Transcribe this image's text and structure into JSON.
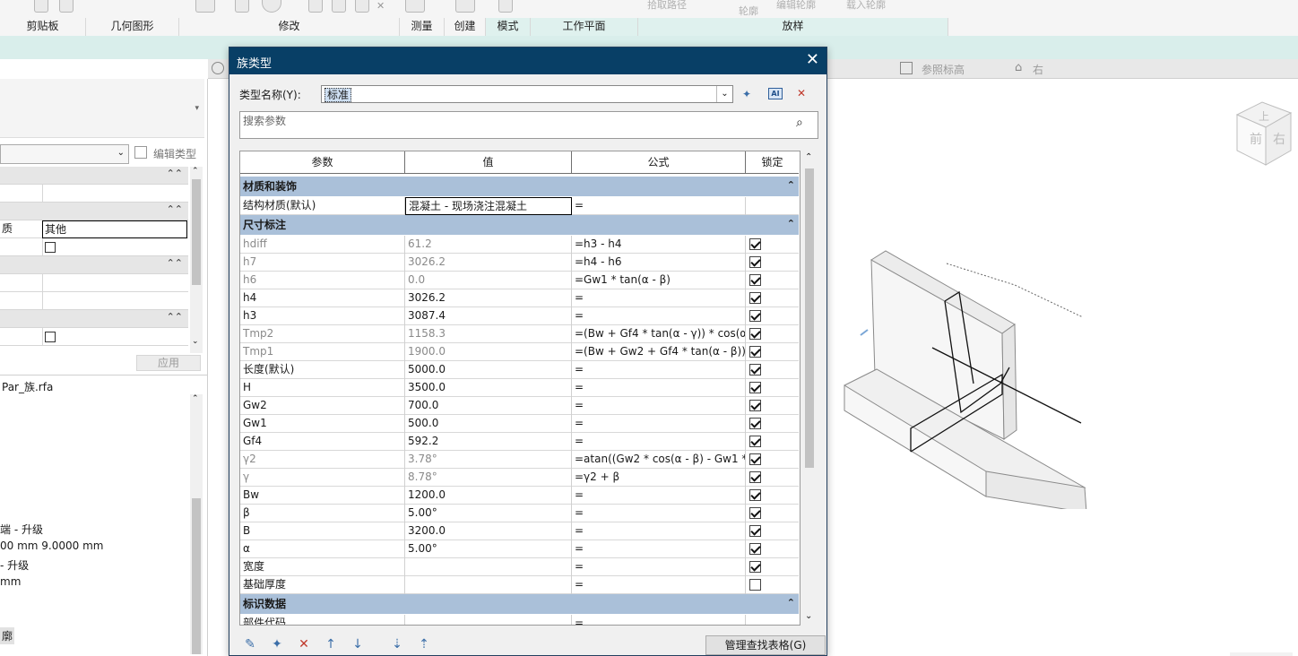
{
  "ribbon": {
    "groups": [
      "剪贴板",
      "几何图形",
      "修改",
      "测量",
      "创建",
      "模式",
      "工作平面",
      "放样"
    ],
    "ghost_labels": [
      "拾取路径",
      "轮廓",
      "编辑轮廓",
      "载入轮廓"
    ]
  },
  "view_tabs": {
    "tab1": "参照标高",
    "tab2": "右"
  },
  "left_panel": {
    "edit_type": "编辑类型",
    "other_label": "其他",
    "row_label_fragment": "质",
    "apply": "应用",
    "file_name": "Par_族.rfa",
    "list": [
      "端 - 升级",
      "00 mm 9.0000 mm",
      "- 升级",
      "mm"
    ],
    "badge": "廓"
  },
  "view_cube": {
    "face_front": "前",
    "face_right": "右",
    "face_top": "上"
  },
  "dialog": {
    "title": "族类型",
    "type_name_label": "类型名称(Y):",
    "type_name_value": "标准",
    "search_placeholder": "搜索参数",
    "columns": [
      "参数",
      "值",
      "公式",
      "锁定"
    ],
    "groups": [
      {
        "name": "材质和装饰",
        "rows": [
          {
            "param": "结构材质(默认)",
            "value": "混凝土 - 现场浇注混凝土",
            "formula": "=",
            "lock": null,
            "gray": false
          }
        ]
      },
      {
        "name": "尺寸标注",
        "rows": [
          {
            "param": "hdiff",
            "value": "61.2",
            "formula": "=h3 - h4",
            "lock": true,
            "gray": true
          },
          {
            "param": "h7",
            "value": "3026.2",
            "formula": "=h4 - h6",
            "lock": true,
            "gray": true
          },
          {
            "param": "h6",
            "value": "0.0",
            "formula": "=Gw1 * tan(α - β)",
            "lock": true,
            "gray": true
          },
          {
            "param": "h4",
            "value": "3026.2",
            "formula": "=",
            "lock": true,
            "gray": false
          },
          {
            "param": "h3",
            "value": "3087.4",
            "formula": "=",
            "lock": true,
            "gray": false
          },
          {
            "param": "Tmp2",
            "value": "1158.3",
            "formula": "=(Bw + Gf4 * tan(α - γ)) * cos(α -",
            "lock": true,
            "gray": true
          },
          {
            "param": "Tmp1",
            "value": "1900.0",
            "formula": "=(Bw + Gw2 + Gf4 * tan(α - β)) *",
            "lock": true,
            "gray": true
          },
          {
            "param": "长度(默认)",
            "value": "5000.0",
            "formula": "=",
            "lock": true,
            "gray": false
          },
          {
            "param": "H",
            "value": "3500.0",
            "formula": "=",
            "lock": true,
            "gray": false
          },
          {
            "param": "Gw2",
            "value": "700.0",
            "formula": "=",
            "lock": true,
            "gray": false
          },
          {
            "param": "Gw1",
            "value": "500.0",
            "formula": "=",
            "lock": true,
            "gray": false
          },
          {
            "param": "Gf4",
            "value": "592.2",
            "formula": "=",
            "lock": true,
            "gray": false
          },
          {
            "param": "γ2",
            "value": "3.78°",
            "formula": "=atan((Gw2 * cos(α - β) - Gw1 *",
            "lock": true,
            "gray": true
          },
          {
            "param": "γ",
            "value": "8.78°",
            "formula": "=γ2 + β",
            "lock": true,
            "gray": true
          },
          {
            "param": "Bw",
            "value": "1200.0",
            "formula": "=",
            "lock": true,
            "gray": false
          },
          {
            "param": "β",
            "value": "5.00°",
            "formula": "=",
            "lock": true,
            "gray": false
          },
          {
            "param": "B",
            "value": "3200.0",
            "formula": "=",
            "lock": true,
            "gray": false
          },
          {
            "param": "α",
            "value": "5.00°",
            "formula": "=",
            "lock": true,
            "gray": false
          },
          {
            "param": "宽度",
            "value": "",
            "formula": "=",
            "lock": true,
            "gray": false
          },
          {
            "param": "基础厚度",
            "value": "",
            "formula": "=",
            "lock": false,
            "gray": false
          }
        ]
      },
      {
        "name": "标识数据",
        "rows": [
          {
            "param": "部件代码",
            "value": "",
            "formula": "=",
            "lock": null,
            "gray": false
          }
        ]
      }
    ],
    "manage_button": "管理查找表格(G)"
  },
  "colors": {
    "title_bar": "#083f66",
    "group_header": "#aac0d9",
    "ribbon_teal": "#d9eeeb"
  }
}
